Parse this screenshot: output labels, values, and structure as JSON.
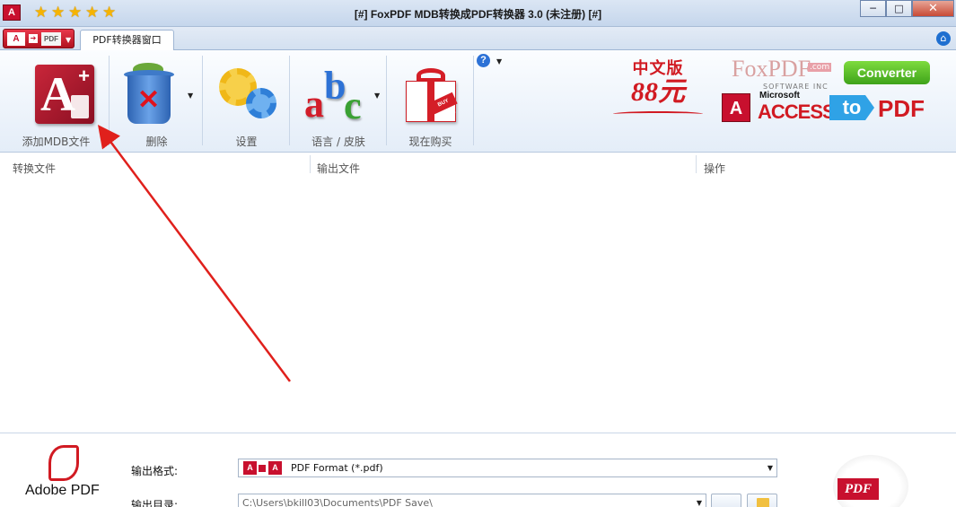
{
  "window": {
    "title": "[#] FoxPDF MDB转换成PDF转换器 3.0 (未注册) [#]",
    "rating_stars": 5,
    "controls": {
      "minimize": "─",
      "maximize": "□",
      "close": "✕"
    }
  },
  "tabs": [
    {
      "label": "PDF转换器窗口"
    }
  ],
  "toolbar": {
    "add_mdb": "添加MDB文件",
    "delete": "删除",
    "settings": "设置",
    "language_skin": "语言 / 皮肤",
    "buy_now": "现在购买",
    "buy_tag": "BUY NOW!"
  },
  "promo": {
    "line1": "中文版",
    "line2": "88元"
  },
  "brand": {
    "fox": "FoxPDF",
    "com": ".com",
    "software": "SOFTWARE INC",
    "converter": "Converter",
    "microsoft": "Microsoft",
    "access": "ACCESS",
    "to": "to",
    "pdf": "PDF"
  },
  "file_list": {
    "columns": [
      "转换文件",
      "输出文件",
      "操作"
    ]
  },
  "output": {
    "format_label": "输出格式:",
    "format_value": "PDF Format (*.pdf)",
    "dir_label": "输出目录:",
    "dir_value": "C:\\Users\\bkill03\\Documents\\PDF Save\\"
  },
  "adobe_logo": {
    "text": "Adobe PDF"
  },
  "big_pdf_icon": {
    "text": "PDF"
  },
  "colors": {
    "accent": "#c8102e",
    "annotation_arrow": "#e0201c",
    "ribbon_bg": "#e4edf8"
  }
}
